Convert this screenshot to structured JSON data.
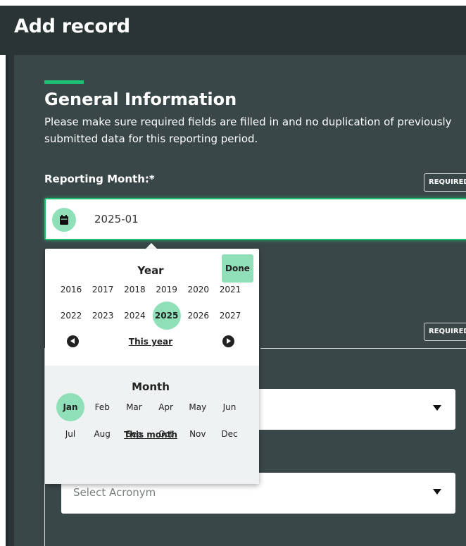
{
  "page": {
    "title": "Add record"
  },
  "section": {
    "title": "General Information",
    "description": "Please make sure required fields are filled in and no duplication of previously submitted data for this reporting period."
  },
  "reporting_month": {
    "label": "Reporting Month:*",
    "required_tag": "REQUIRED",
    "value": "2025-01",
    "icon": "calendar-icon"
  },
  "second_required_tag": "REQUIRED",
  "acronym_select": {
    "placeholder": "Select Acronym"
  },
  "picker": {
    "done_label": "Done",
    "year_heading": "Year",
    "years": [
      "2016",
      "2017",
      "2018",
      "2019",
      "2020",
      "2021",
      "2022",
      "2023",
      "2024",
      "2025",
      "2026",
      "2027"
    ],
    "selected_year": "2025",
    "this_year_link": "This year",
    "month_heading": "Month",
    "months": [
      "Jan",
      "Feb",
      "Mar",
      "Apr",
      "May",
      "Jun",
      "Jul",
      "Aug",
      "Sep",
      "Oct",
      "Nov",
      "Dec"
    ],
    "selected_month": "Jan",
    "this_month_link": "This month"
  },
  "colors": {
    "accent": "#1fbf72",
    "selection": "#8fe0b8",
    "page_bg": "#2b3435",
    "panel_bg": "#3a4748"
  }
}
